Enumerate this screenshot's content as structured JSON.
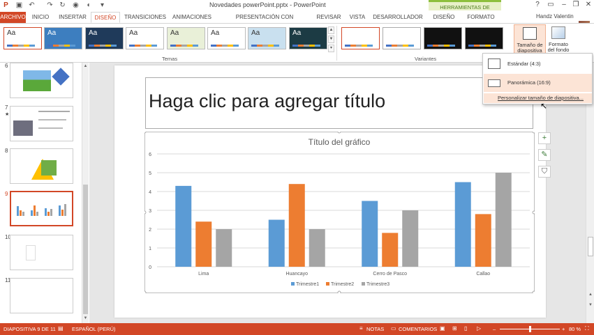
{
  "window": {
    "title": "Novedades powerPoint.pptx - PowerPoint",
    "context_tab_group": "HERRAMIENTAS DE GRÁFICOS",
    "user": "Handz Valentin",
    "controls": [
      "?",
      "▭",
      "–",
      "❐",
      "✕"
    ]
  },
  "tabs": [
    {
      "label": "ARCHIVO"
    },
    {
      "label": "INICIO"
    },
    {
      "label": "INSERTAR"
    },
    {
      "label": "DISEÑO"
    },
    {
      "label": "TRANSICIONES"
    },
    {
      "label": "ANIMACIONES"
    },
    {
      "label": "PRESENTACIÓN CON DIAPOSITIVAS"
    },
    {
      "label": "REVISAR"
    },
    {
      "label": "VISTA"
    },
    {
      "label": "DESARROLLADOR"
    },
    {
      "label": "DISEÑO"
    },
    {
      "label": "FORMATO"
    }
  ],
  "ribbon": {
    "themes_label": "Temas",
    "variants_label": "Variantes",
    "theme_thumbs": [
      "Aa",
      "Aa",
      "Aa",
      "Aa",
      "Aa",
      "Aa",
      "Aa",
      "Aa"
    ],
    "theme_colors": [
      "#ffffff",
      "#3d7ebf",
      "#1f3a5a",
      "#ffffff",
      "#e9f0d8",
      "#ffffff",
      "#c9e0ef",
      "#1c3b44"
    ],
    "variant_colors": [
      "#ffffff",
      "#ffffff",
      "#111111",
      "#111111"
    ],
    "slide_size_button": "Tamaño de diapositiva",
    "bg_format_button": "Formato del fondo"
  },
  "dropdown": {
    "items": [
      "Estándar (4:3)",
      "Panorámica (16:9)"
    ],
    "custom": "Personalizar tamaño de diapositiva..."
  },
  "slides": {
    "numbers": [
      "6",
      "7",
      "8",
      "9",
      "10",
      "11"
    ],
    "star": "★",
    "selected": "9"
  },
  "slide": {
    "title_placeholder": "Haga clic para agregar título"
  },
  "chart_data": {
    "type": "bar",
    "title": "Título del gráfico",
    "categories": [
      "Lima",
      "Huancayo",
      "Cerro de Pasco",
      "Callao"
    ],
    "series": [
      {
        "name": "Trimestre1",
        "values": [
          4.3,
          2.5,
          3.5,
          4.5
        ],
        "color": "#5b9bd5"
      },
      {
        "name": "Trimestre2",
        "values": [
          2.4,
          4.4,
          1.8,
          2.8
        ],
        "color": "#ed7d31"
      },
      {
        "name": "Trimestre3",
        "values": [
          2.0,
          2.0,
          3.0,
          5.0
        ],
        "color": "#a5a5a5"
      }
    ],
    "ylim": [
      0,
      6
    ],
    "yticks": [
      "0",
      "1",
      "2",
      "3",
      "4",
      "5",
      "6"
    ],
    "grid": true,
    "legend": "bottom"
  },
  "chart_tools": [
    "+",
    "✎",
    "⛉"
  ],
  "status": {
    "slide_info": "DIAPOSITIVA 9 DE 11",
    "language": "ESPAÑOL (PERÚ)",
    "notes": "NOTAS",
    "comments": "COMENTARIOS",
    "zoom": "80 %"
  },
  "colors": {
    "accent": "#d24726"
  }
}
